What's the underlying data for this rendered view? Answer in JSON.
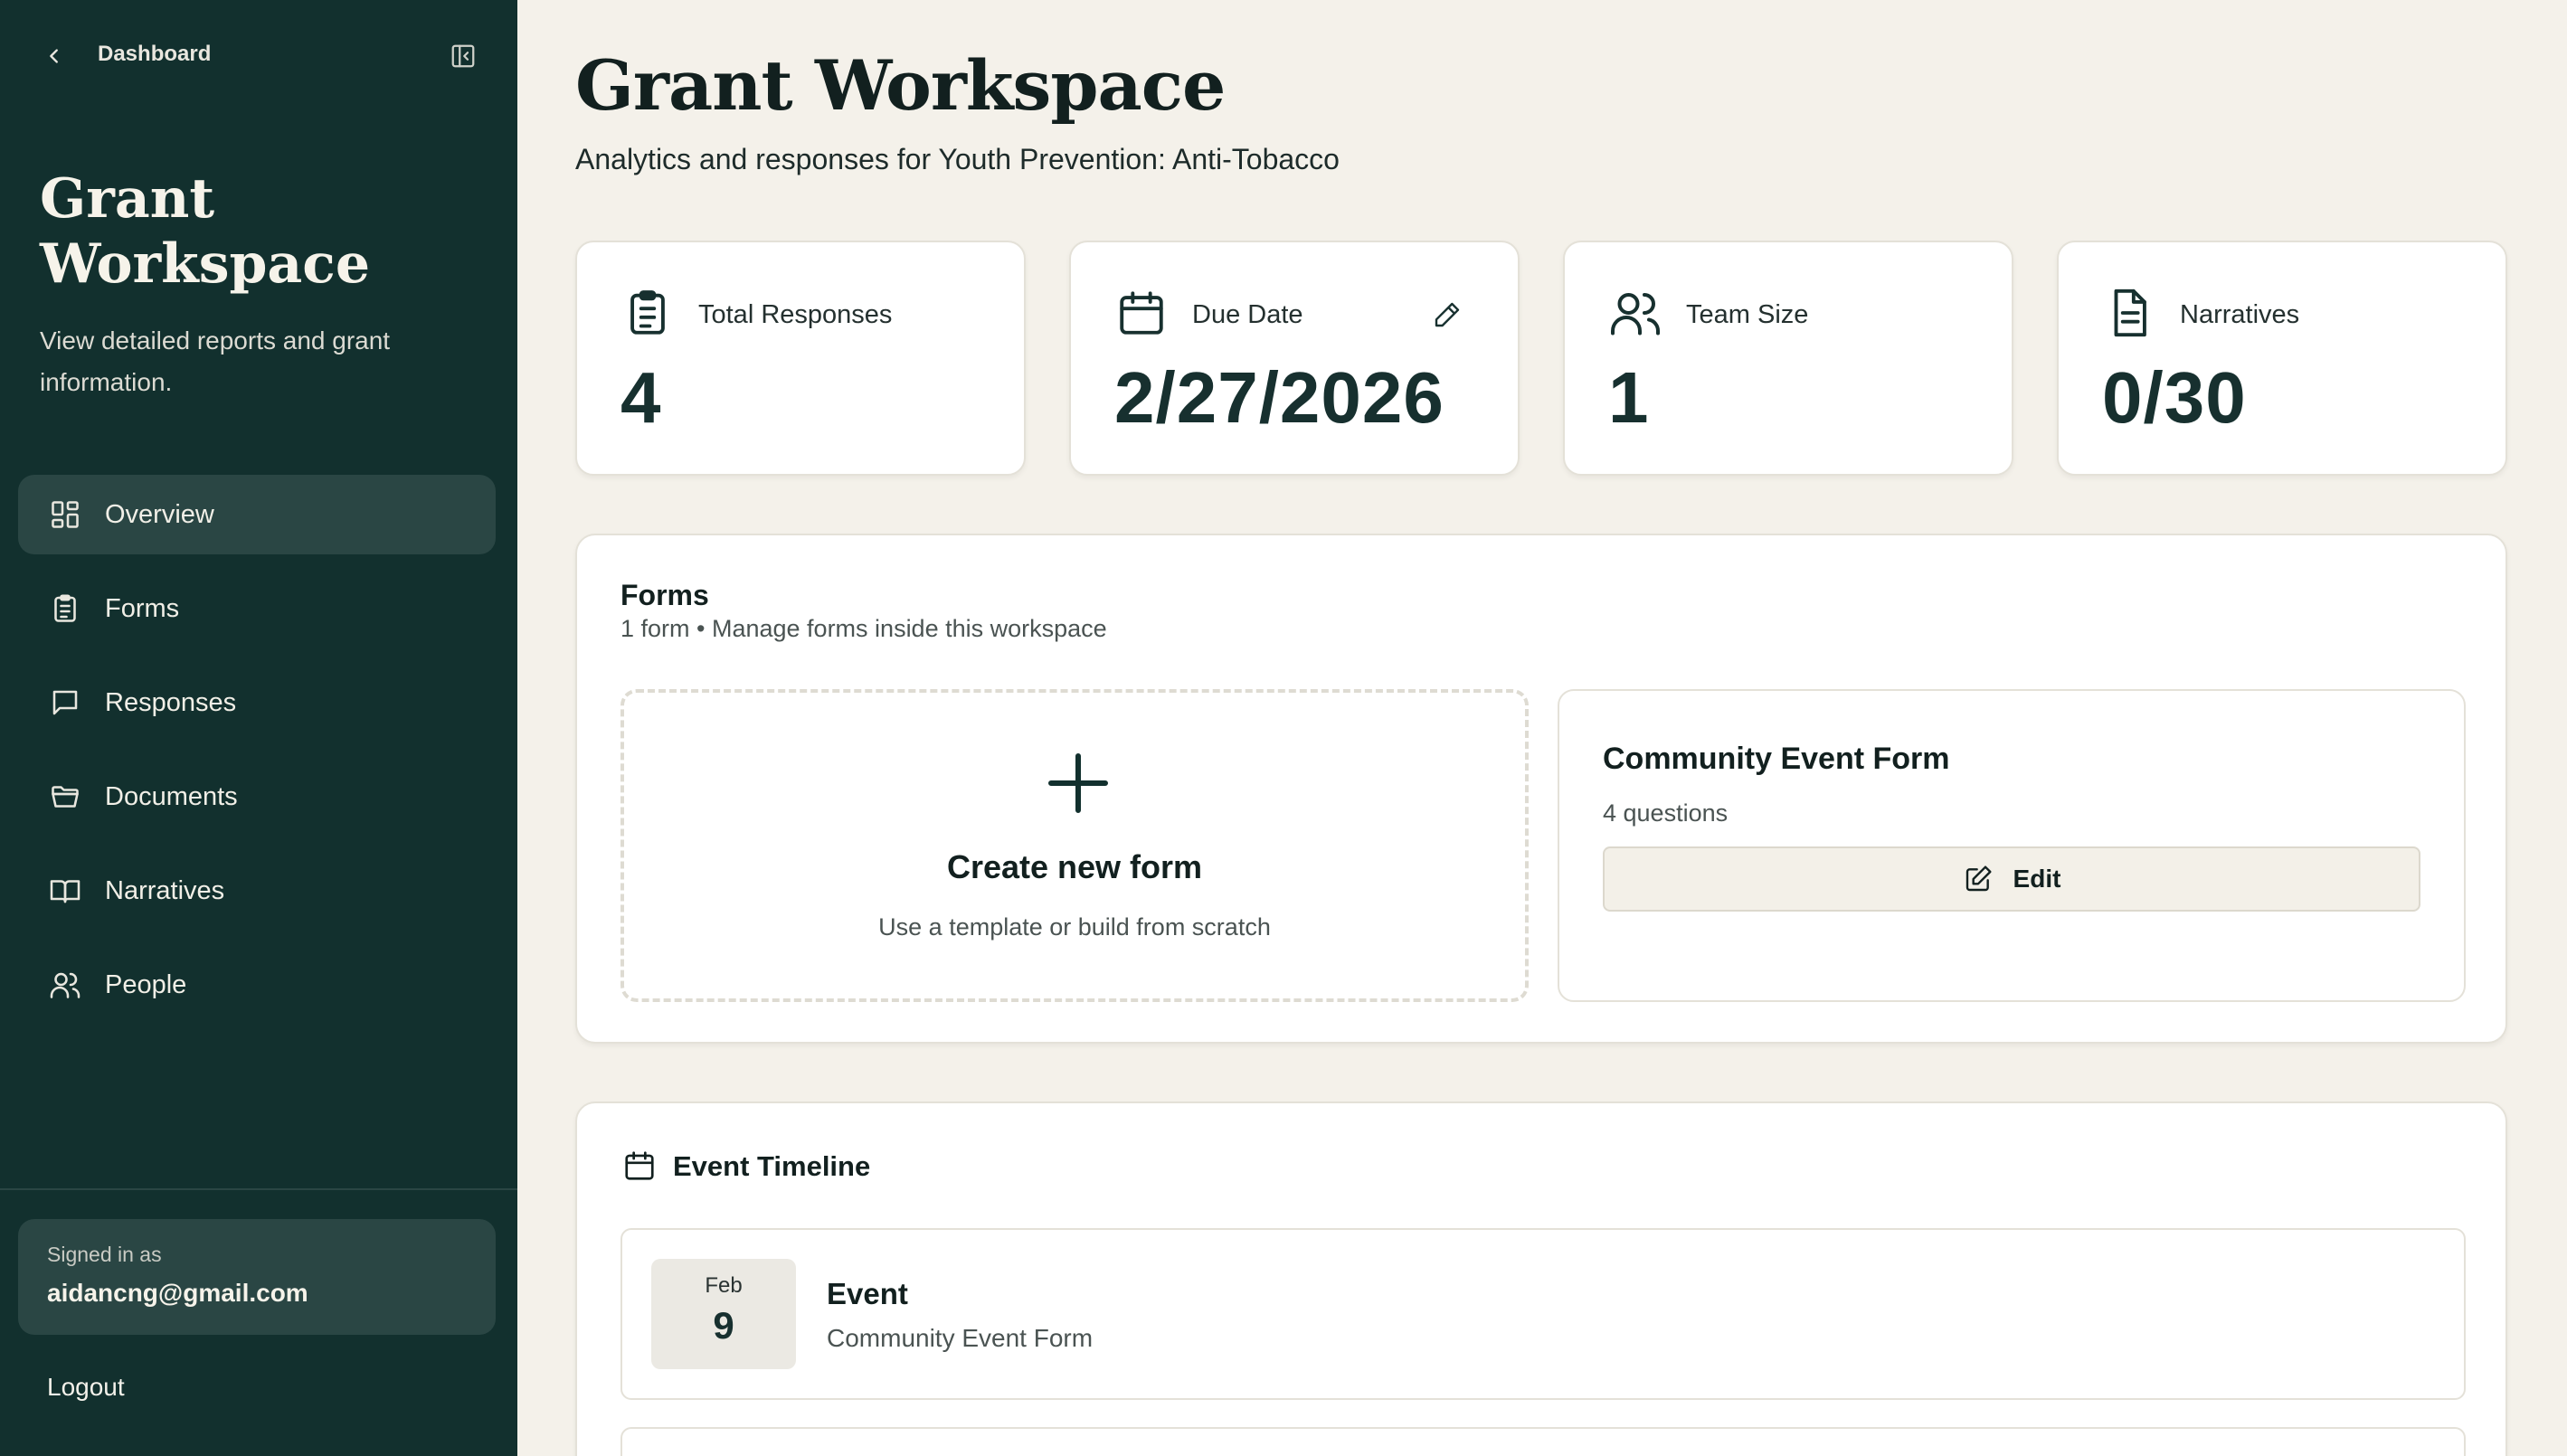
{
  "sidebar": {
    "back_label": "Dashboard",
    "title": "Grant Workspace",
    "description": "View detailed reports and grant information.",
    "nav": [
      {
        "label": "Overview",
        "icon": "grid-icon",
        "active": true
      },
      {
        "label": "Forms",
        "icon": "clipboard-icon"
      },
      {
        "label": "Responses",
        "icon": "chat-icon"
      },
      {
        "label": "Documents",
        "icon": "folder-icon"
      },
      {
        "label": "Narratives",
        "icon": "book-icon"
      },
      {
        "label": "People",
        "icon": "users-icon"
      }
    ],
    "signed_in_label": "Signed in as",
    "user_email": "aidancng@gmail.com",
    "logout_label": "Logout"
  },
  "main": {
    "title": "Grant Workspace",
    "subtitle": "Analytics and responses for Youth Prevention: Anti-Tobacco",
    "stats": [
      {
        "label": "Total Responses",
        "value": "4",
        "icon": "clipboard-icon"
      },
      {
        "label": "Due Date",
        "value": "2/27/2026",
        "icon": "calendar-icon"
      },
      {
        "label": "Team Size",
        "value": "1",
        "icon": "users-icon"
      },
      {
        "label": "Narratives",
        "value": "0/30",
        "icon": "document-icon"
      }
    ],
    "forms": {
      "title": "Forms",
      "subtitle": "1 form • Manage forms inside this workspace",
      "create_title": "Create new form",
      "create_sub": "Use a template or build from scratch",
      "card": {
        "title": "Community Event Form",
        "questions": "4 questions",
        "edit_label": "Edit"
      }
    },
    "timeline": {
      "title": "Event Timeline",
      "events": [
        {
          "month": "Feb",
          "day": "9",
          "name": "Event",
          "form": "Community Event Form"
        }
      ]
    }
  },
  "colors": {
    "sidebar_bg": "#12302e",
    "sidebar_active": "#2a4644",
    "page_bg": "#f4f1ea",
    "card_bg": "#ffffff",
    "text_dark": "#12201f"
  }
}
